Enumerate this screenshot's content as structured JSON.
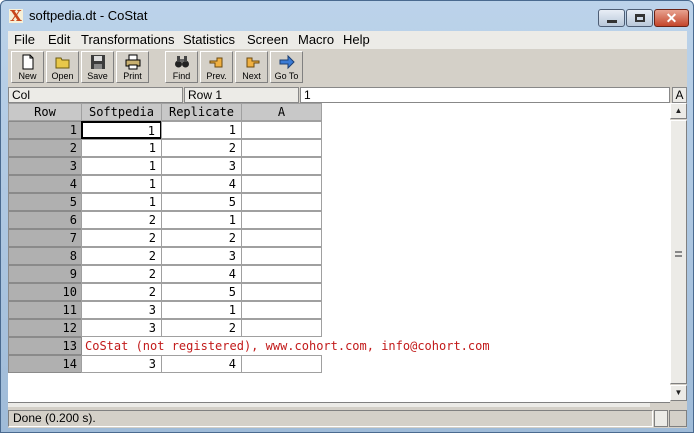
{
  "window": {
    "title": "softpedia.dt - CoStat"
  },
  "menu": [
    "File",
    "Edit",
    "Transformations",
    "Statistics",
    "Screen",
    "Macro",
    "Help"
  ],
  "toolbar": [
    {
      "label": "New",
      "icon": "new-file-icon"
    },
    {
      "label": "Open",
      "icon": "open-folder-icon"
    },
    {
      "label": "Save",
      "icon": "save-disk-icon"
    },
    {
      "label": "Print",
      "icon": "printer-icon"
    },
    {
      "label": "Find",
      "icon": "binoculars-icon"
    },
    {
      "label": "Prev.",
      "icon": "hand-left-icon"
    },
    {
      "label": "Next",
      "icon": "hand-right-icon"
    },
    {
      "label": "Go To",
      "icon": "arrow-right-icon"
    }
  ],
  "editrow": {
    "col": "Col",
    "row": "Row 1",
    "value": "1",
    "a_button": "A"
  },
  "grid": {
    "headers": [
      "Row",
      "Softpedia",
      "Replicate",
      "A"
    ],
    "rows": [
      {
        "row": "1",
        "softpedia": "1",
        "replicate": "1",
        "a": ""
      },
      {
        "row": "2",
        "softpedia": "1",
        "replicate": "2",
        "a": ""
      },
      {
        "row": "3",
        "softpedia": "1",
        "replicate": "3",
        "a": ""
      },
      {
        "row": "4",
        "softpedia": "1",
        "replicate": "4",
        "a": ""
      },
      {
        "row": "5",
        "softpedia": "1",
        "replicate": "5",
        "a": ""
      },
      {
        "row": "6",
        "softpedia": "2",
        "replicate": "1",
        "a": ""
      },
      {
        "row": "7",
        "softpedia": "2",
        "replicate": "2",
        "a": ""
      },
      {
        "row": "8",
        "softpedia": "2",
        "replicate": "3",
        "a": ""
      },
      {
        "row": "9",
        "softpedia": "2",
        "replicate": "4",
        "a": ""
      },
      {
        "row": "10",
        "softpedia": "2",
        "replicate": "5",
        "a": ""
      },
      {
        "row": "11",
        "softpedia": "3",
        "replicate": "1",
        "a": ""
      },
      {
        "row": "12",
        "softpedia": "3",
        "replicate": "2",
        "a": ""
      },
      {
        "row": "13",
        "note": "CoStat (not registered), www.cohort.com, info@cohort.com"
      },
      {
        "row": "14",
        "softpedia": "3",
        "replicate": "4",
        "a": ""
      }
    ]
  },
  "status": {
    "text": "Done (0.200 s)."
  },
  "colors": {
    "note_text": "#c21a1a",
    "row_header": "#b0b0b0",
    "column_header": "#c8c8c8"
  }
}
